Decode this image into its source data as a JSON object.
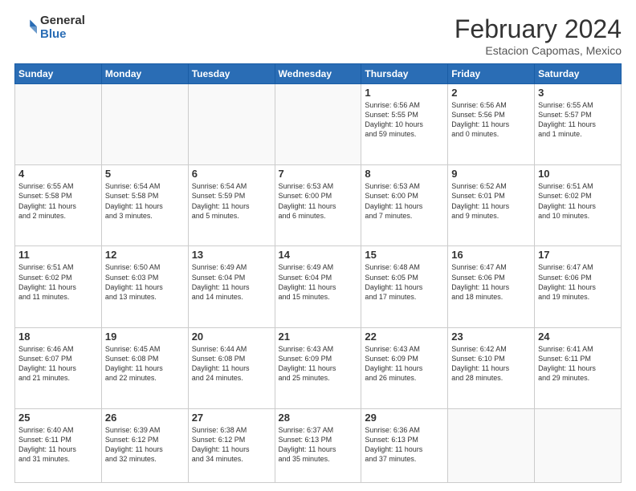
{
  "logo": {
    "general": "General",
    "blue": "Blue"
  },
  "header": {
    "title": "February 2024",
    "location": "Estacion Capomas, Mexico"
  },
  "weekdays": [
    "Sunday",
    "Monday",
    "Tuesday",
    "Wednesday",
    "Thursday",
    "Friday",
    "Saturday"
  ],
  "weeks": [
    [
      {
        "day": "",
        "info": ""
      },
      {
        "day": "",
        "info": ""
      },
      {
        "day": "",
        "info": ""
      },
      {
        "day": "",
        "info": ""
      },
      {
        "day": "1",
        "info": "Sunrise: 6:56 AM\nSunset: 5:55 PM\nDaylight: 10 hours\nand 59 minutes."
      },
      {
        "day": "2",
        "info": "Sunrise: 6:56 AM\nSunset: 5:56 PM\nDaylight: 11 hours\nand 0 minutes."
      },
      {
        "day": "3",
        "info": "Sunrise: 6:55 AM\nSunset: 5:57 PM\nDaylight: 11 hours\nand 1 minute."
      }
    ],
    [
      {
        "day": "4",
        "info": "Sunrise: 6:55 AM\nSunset: 5:58 PM\nDaylight: 11 hours\nand 2 minutes."
      },
      {
        "day": "5",
        "info": "Sunrise: 6:54 AM\nSunset: 5:58 PM\nDaylight: 11 hours\nand 3 minutes."
      },
      {
        "day": "6",
        "info": "Sunrise: 6:54 AM\nSunset: 5:59 PM\nDaylight: 11 hours\nand 5 minutes."
      },
      {
        "day": "7",
        "info": "Sunrise: 6:53 AM\nSunset: 6:00 PM\nDaylight: 11 hours\nand 6 minutes."
      },
      {
        "day": "8",
        "info": "Sunrise: 6:53 AM\nSunset: 6:00 PM\nDaylight: 11 hours\nand 7 minutes."
      },
      {
        "day": "9",
        "info": "Sunrise: 6:52 AM\nSunset: 6:01 PM\nDaylight: 11 hours\nand 9 minutes."
      },
      {
        "day": "10",
        "info": "Sunrise: 6:51 AM\nSunset: 6:02 PM\nDaylight: 11 hours\nand 10 minutes."
      }
    ],
    [
      {
        "day": "11",
        "info": "Sunrise: 6:51 AM\nSunset: 6:02 PM\nDaylight: 11 hours\nand 11 minutes."
      },
      {
        "day": "12",
        "info": "Sunrise: 6:50 AM\nSunset: 6:03 PM\nDaylight: 11 hours\nand 13 minutes."
      },
      {
        "day": "13",
        "info": "Sunrise: 6:49 AM\nSunset: 6:04 PM\nDaylight: 11 hours\nand 14 minutes."
      },
      {
        "day": "14",
        "info": "Sunrise: 6:49 AM\nSunset: 6:04 PM\nDaylight: 11 hours\nand 15 minutes."
      },
      {
        "day": "15",
        "info": "Sunrise: 6:48 AM\nSunset: 6:05 PM\nDaylight: 11 hours\nand 17 minutes."
      },
      {
        "day": "16",
        "info": "Sunrise: 6:47 AM\nSunset: 6:06 PM\nDaylight: 11 hours\nand 18 minutes."
      },
      {
        "day": "17",
        "info": "Sunrise: 6:47 AM\nSunset: 6:06 PM\nDaylight: 11 hours\nand 19 minutes."
      }
    ],
    [
      {
        "day": "18",
        "info": "Sunrise: 6:46 AM\nSunset: 6:07 PM\nDaylight: 11 hours\nand 21 minutes."
      },
      {
        "day": "19",
        "info": "Sunrise: 6:45 AM\nSunset: 6:08 PM\nDaylight: 11 hours\nand 22 minutes."
      },
      {
        "day": "20",
        "info": "Sunrise: 6:44 AM\nSunset: 6:08 PM\nDaylight: 11 hours\nand 24 minutes."
      },
      {
        "day": "21",
        "info": "Sunrise: 6:43 AM\nSunset: 6:09 PM\nDaylight: 11 hours\nand 25 minutes."
      },
      {
        "day": "22",
        "info": "Sunrise: 6:43 AM\nSunset: 6:09 PM\nDaylight: 11 hours\nand 26 minutes."
      },
      {
        "day": "23",
        "info": "Sunrise: 6:42 AM\nSunset: 6:10 PM\nDaylight: 11 hours\nand 28 minutes."
      },
      {
        "day": "24",
        "info": "Sunrise: 6:41 AM\nSunset: 6:11 PM\nDaylight: 11 hours\nand 29 minutes."
      }
    ],
    [
      {
        "day": "25",
        "info": "Sunrise: 6:40 AM\nSunset: 6:11 PM\nDaylight: 11 hours\nand 31 minutes."
      },
      {
        "day": "26",
        "info": "Sunrise: 6:39 AM\nSunset: 6:12 PM\nDaylight: 11 hours\nand 32 minutes."
      },
      {
        "day": "27",
        "info": "Sunrise: 6:38 AM\nSunset: 6:12 PM\nDaylight: 11 hours\nand 34 minutes."
      },
      {
        "day": "28",
        "info": "Sunrise: 6:37 AM\nSunset: 6:13 PM\nDaylight: 11 hours\nand 35 minutes."
      },
      {
        "day": "29",
        "info": "Sunrise: 6:36 AM\nSunset: 6:13 PM\nDaylight: 11 hours\nand 37 minutes."
      },
      {
        "day": "",
        "info": ""
      },
      {
        "day": "",
        "info": ""
      }
    ]
  ]
}
